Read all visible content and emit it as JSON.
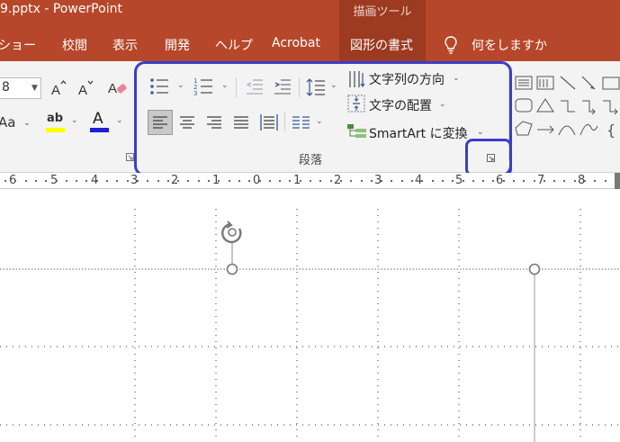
{
  "window": {
    "title": "9.pptx  -  PowerPoint",
    "context_label": "描画ツール"
  },
  "tabs": [
    "ショー",
    "校閲",
    "表示",
    "開発",
    "ヘルプ",
    "Acrobat",
    "図形の書式"
  ],
  "tell_me": "何をしますか",
  "font": {
    "size_value": "8",
    "aa_label": "Aa"
  },
  "paragraph": {
    "text_direction": "文字列の方向",
    "align_text": "文字の配置",
    "smartart": "SmartArt に変換",
    "group_label": "段落"
  },
  "ruler": {
    "numbers": [
      "6",
      "5",
      "4",
      "3",
      "2",
      "1",
      "0",
      "1",
      "2",
      "3",
      "4",
      "5",
      "6",
      "7",
      "8"
    ]
  },
  "colors": {
    "title_bar": "#b7472a",
    "context_tab": "#9c3a22",
    "highlight": "#3b3ec7",
    "font_color_bar": "#1f1fd6",
    "highlight_bar": "#ffff00"
  },
  "icons": [
    "increase-font-icon",
    "decrease-font-icon",
    "clear-format-icon",
    "bullets-icon",
    "numbering-icon",
    "decrease-indent-icon",
    "increase-indent-icon",
    "line-spacing-icon",
    "text-direction-icon",
    "align-text-icon",
    "smartart-icon",
    "align-left-icon",
    "align-center-icon",
    "align-right-icon",
    "justify-icon",
    "distribute-icon",
    "columns-icon",
    "dialog-launcher-icon",
    "rotate-handle-icon",
    "lightbulb-icon"
  ]
}
